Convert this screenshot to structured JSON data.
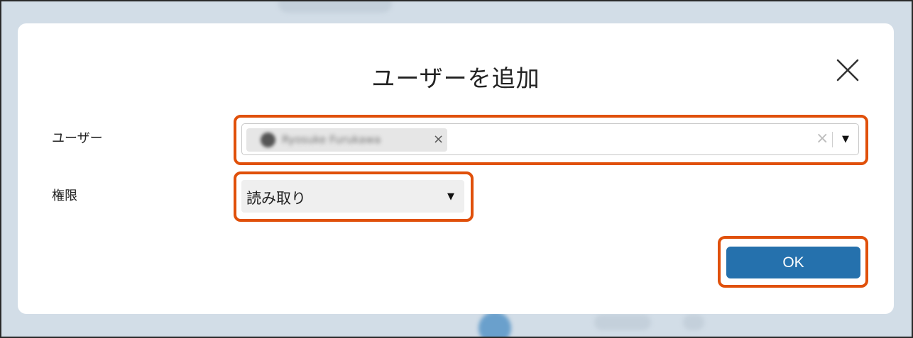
{
  "dialog": {
    "title": "ユーザーを追加",
    "close_icon": "close-icon"
  },
  "fields": {
    "user": {
      "label": "ユーザー",
      "chip_name": "Ryosuke Furukawa",
      "chip_remove": "×",
      "clear_all": "×",
      "arrow": "▼"
    },
    "permission": {
      "label": "権限",
      "value": "読み取り",
      "arrow": "▼"
    }
  },
  "actions": {
    "ok_label": "OK"
  },
  "colors": {
    "highlight": "#e0500a",
    "ok_button": "#2571ad",
    "backdrop": "#d2dde7"
  }
}
